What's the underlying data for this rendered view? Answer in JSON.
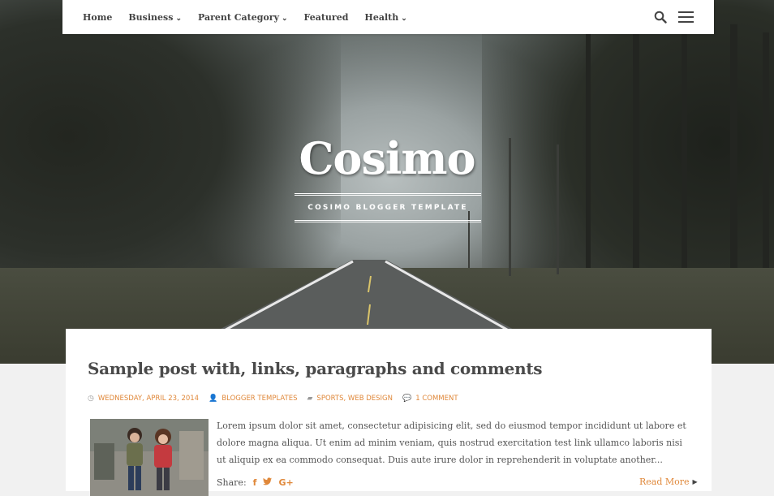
{
  "nav": {
    "items": [
      {
        "label": "Home",
        "has_dropdown": false
      },
      {
        "label": "Business",
        "has_dropdown": true
      },
      {
        "label": "Parent Category",
        "has_dropdown": true
      },
      {
        "label": "Featured",
        "has_dropdown": false
      },
      {
        "label": "Health",
        "has_dropdown": true
      }
    ],
    "dropdown_glyph": "⌄",
    "search_icon": "search-icon",
    "menu_icon": "hamburger-icon"
  },
  "hero": {
    "site_title": "Cosimo",
    "tagline": "COSIMO BLOGGER TEMPLATE"
  },
  "post": {
    "title": "Sample post with, links, paragraphs and comments",
    "meta": {
      "date": "WEDNESDAY, APRIL 23, 2014",
      "author": "BLOGGER TEMPLATES",
      "categories": "SPORTS, WEB DESIGN",
      "comments": "1 COMMENT"
    },
    "excerpt": "Lorem ipsum dolor sit amet, consectetur adipisicing elit, sed do eiusmod tempor incididunt ut labore et dolore magna aliqua. Ut enim ad minim veniam, quis nostrud exercitation test link ullamco laboris nisi ut aliquip ex ea commodo consequat. Duis aute irure dolor in reprehenderit in voluptate another...",
    "share_label": "Share:",
    "share_icons": {
      "facebook": "f",
      "twitter": "🐦",
      "google_plus": "G+"
    },
    "read_more": "Read More"
  },
  "colors": {
    "accent": "#e0883a",
    "nav_text": "#444444",
    "title_text": "#4a4a4a",
    "body_text": "#555555"
  }
}
